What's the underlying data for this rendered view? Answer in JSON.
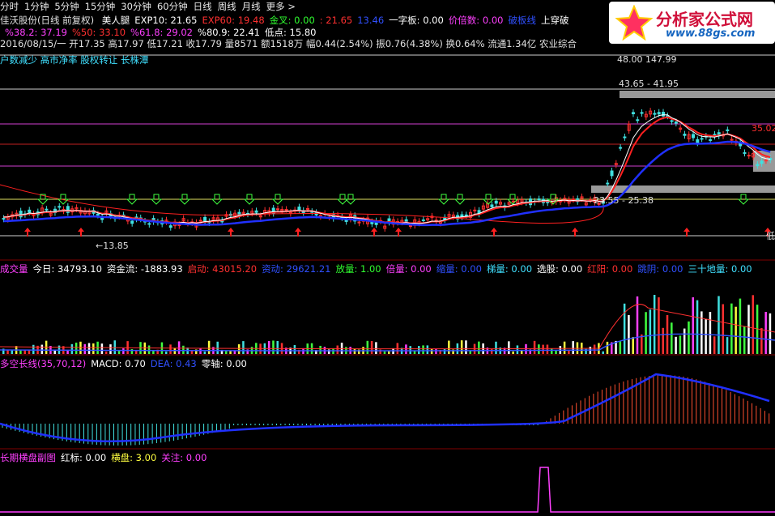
{
  "menu": [
    "分时",
    "1分钟",
    "5分钟",
    "15分钟",
    "30分钟",
    "60分钟",
    "日线",
    "周线",
    "月线",
    "更多 >"
  ],
  "main_header": {
    "stock": "佳沃股份(日线 前复权)",
    "items": [
      {
        "label": "美人腿",
        "color": "#ffffff"
      },
      {
        "label": "EXP10: 21.65",
        "color": "#ffffff"
      },
      {
        "label": "EXP60: 19.48",
        "color": "#ff3030"
      },
      {
        "label": "金叉: 0.00",
        "color": "#30ff30"
      },
      {
        "label": ": 21.65",
        "color": "#ff3030"
      },
      {
        "label": "13.46",
        "color": "#3050ff"
      },
      {
        "label": "一字板: 0.00",
        "color": "#ffffff"
      },
      {
        "label": "价倍数: 0.00",
        "color": "#ff40ff"
      },
      {
        "label": "破板线",
        "color": "#3050ff"
      },
      {
        "label": "上穿破",
        "color": "#ffffff"
      }
    ]
  },
  "fib_row": [
    {
      "label": "%38.2: 37.19",
      "color": "#ff40ff"
    },
    {
      "label": "%50: 33.10",
      "color": "#ff3030"
    },
    {
      "label": "%61.8: 29.02",
      "color": "#ff40ff"
    },
    {
      "label": "%80.9: 22.41",
      "color": "#ffffff"
    },
    {
      "label": "低点: 15.80",
      "color": "#ffffff"
    }
  ],
  "quote_row": "2016/08/15/一 开17.35 高17.97 低17.21 收17.79 量8571 额1518万 幅0.44(2.54%) 振0.76(4.38%) 换0.64% 流通1.34亿 农业综合",
  "info_row": "户数减少 高市净率 股权转让 长株潭",
  "price_labels": {
    "top": "48.00 147.99",
    "range_top": "43.65 - 41.95",
    "right_mid": "35.02",
    "range_bottom": "23.55 - 25.38",
    "low": "13.85",
    "low_tag": "低",
    "pct": "%"
  },
  "volume_header": [
    {
      "label": "成交量",
      "color": "#ff40ff"
    },
    {
      "label": "今日: 34793.10",
      "color": "#ffffff"
    },
    {
      "label": "资金流: -1883.93",
      "color": "#ffffff"
    },
    {
      "label": "启动: 43015.20",
      "color": "#ff3030"
    },
    {
      "label": "资动: 29621.21",
      "color": "#3050ff"
    },
    {
      "label": "放量: 1.00",
      "color": "#30ff30"
    },
    {
      "label": "倍量: 0.00",
      "color": "#ff40ff"
    },
    {
      "label": "缩量: 0.00",
      "color": "#3050ff"
    },
    {
      "label": "梯量: 0.00",
      "color": "#40e0ff"
    },
    {
      "label": "选股: 0.00",
      "color": "#ffffff"
    },
    {
      "label": "红阳: 0.00",
      "color": "#ff3030"
    },
    {
      "label": "跳阴: 0.00",
      "color": "#3050ff"
    },
    {
      "label": "三十地量: 0.00",
      "color": "#40e0ff"
    }
  ],
  "macd_header": [
    {
      "label": "多空长线(35,70,12)",
      "color": "#ff40ff"
    },
    {
      "label": "MACD: 0.70",
      "color": "#ffffff"
    },
    {
      "label": "DEA: 0.43",
      "color": "#3050ff"
    },
    {
      "label": "零轴: 0.00",
      "color": "#ffffff"
    }
  ],
  "sub_header": [
    {
      "label": "长期横盘副图",
      "color": "#ff40ff"
    },
    {
      "label": "红标: 0.00",
      "color": "#ffffff"
    },
    {
      "label": "横盘: 3.00",
      "color": "#ffff40"
    },
    {
      "label": "关注: 0.00",
      "color": "#ff40ff"
    }
  ],
  "logo": {
    "main": "分析家公式网",
    "url": "www.88gs.com"
  },
  "colors": {
    "bg": "#000000",
    "up": "#ff3030",
    "down": "#40e0e0",
    "ma_red": "#ff2020",
    "ma_blue": "#2030ff",
    "ma_white": "#ffffff",
    "hline_magenta": "#d040d0",
    "hline_red": "#c02020",
    "hline_yellow": "#e0e060",
    "gray_band": "#999999"
  }
}
